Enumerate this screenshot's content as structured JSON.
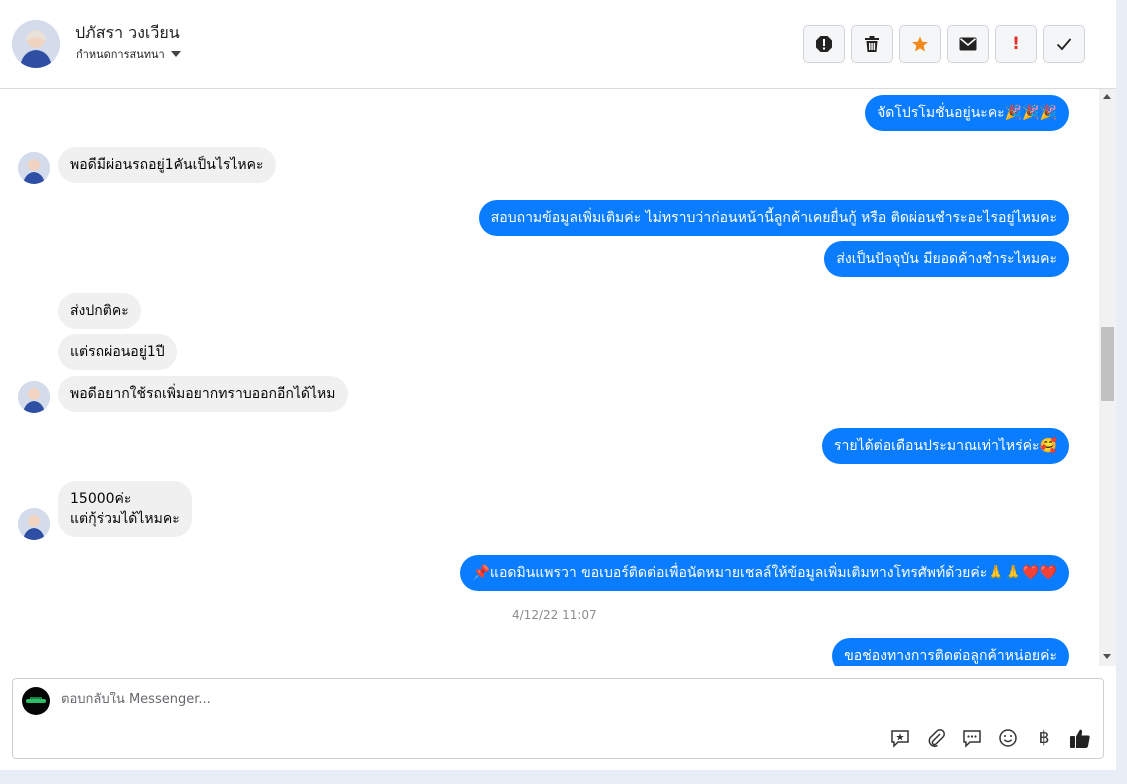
{
  "header": {
    "name": "ปภัสรา วงเวียน",
    "subtitle": "กำหนดการสนทนา",
    "actions": [
      {
        "name": "report-icon",
        "label": "!"
      },
      {
        "name": "trash-icon",
        "label": ""
      },
      {
        "name": "star-icon",
        "label": ""
      },
      {
        "name": "mail-icon",
        "label": ""
      },
      {
        "name": "priority-icon",
        "label": "!"
      },
      {
        "name": "check-icon",
        "label": ""
      }
    ]
  },
  "messages": [
    {
      "dir": "out",
      "text": "จัดโปรโมชั่นอยู่นะคะ🎉🎉🎉"
    },
    {
      "dir": "in",
      "text": "พอดีมีผ่อนรถอยู่1คันเป็นไรไหคะ"
    },
    {
      "dir": "out",
      "text": "สอบถามข้อมูลเพิ่มเติมค่ะ  ไม่ทราบว่าก่อนหน้านี้ลูกค้าเคยยื่นกู้ หรือ ติดผ่อนชำระอะไรอยู่ไหมคะ"
    },
    {
      "dir": "out",
      "text": "ส่งเป็นปัจจุบัน มียอดค้างชำระไหมคะ"
    },
    {
      "dir": "in",
      "text": "ส่งปกติคะ"
    },
    {
      "dir": "in",
      "text": "แต่รถผ่อนอยู่1ปี"
    },
    {
      "dir": "in",
      "text": "พอดีอยากใช้รถเพิ่มอยากทราบออกอีกได้ไหม"
    },
    {
      "dir": "out",
      "text": "รายได้ต่อเดือนประมาณเท่าไหร่ค่ะ🥰"
    },
    {
      "dir": "in",
      "text": "15000ค่ะ",
      "text2": "แต่กุ้ร่วมได้ไหมคะ"
    },
    {
      "dir": "out",
      "text": "📌แอดมินแพรวา ขอเบอร์ติดต่อเพื่อนัดหมายเชลล์ให้ข้อมูลเพิ่มเติมทางโทรศัพท์ด้วยค่ะ🙏🙏❤️❤️"
    },
    {
      "dir": "out",
      "text": "ขอช่องทางการติดต่อลูกค้าหน่อยค่ะ"
    }
  ],
  "timestamp": "4/12/22 11:07",
  "composer": {
    "placeholder": "ตอบกลับใน Messenger...",
    "tools": [
      "sticker-icon",
      "attachment-icon",
      "saved-replies-icon",
      "emoji-icon",
      "baht-icon",
      "like-icon"
    ],
    "baht_glyph": "฿"
  },
  "colors": {
    "outgoing_bubble": "#0a7cff",
    "incoming_bubble": "#f0f0f0",
    "star": "#f28a1a",
    "priority": "#e4312b"
  }
}
